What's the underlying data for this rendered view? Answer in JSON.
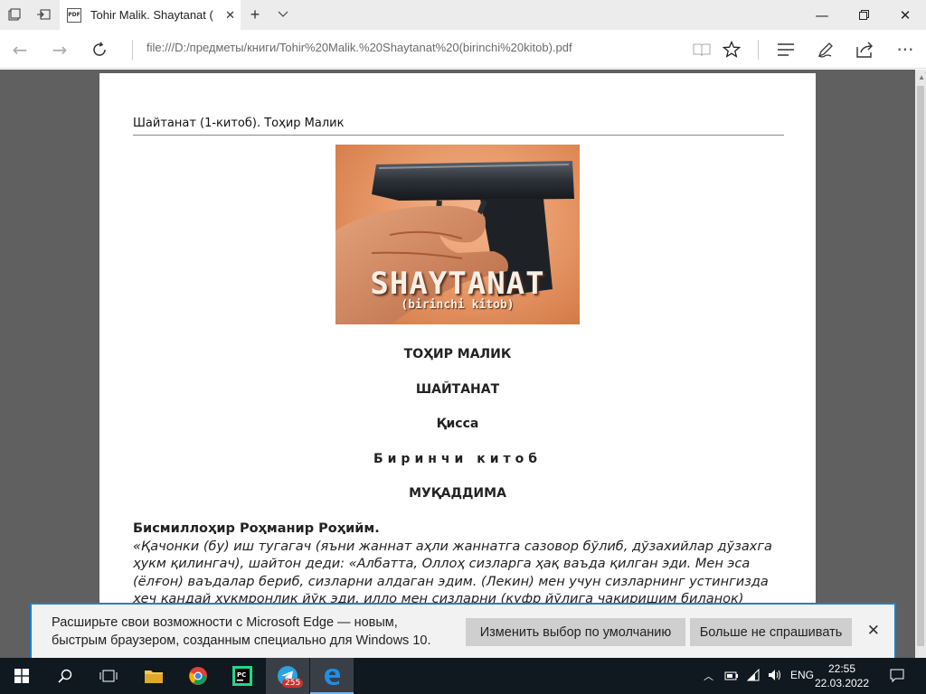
{
  "browser": {
    "tab_title": "Tohir Malik. Shaytanat (",
    "tab_icon": "pdf-icon",
    "address": "file:///D:/предметы/книги/Tohir%20Malik.%20Shaytanat%20(birinchi%20kitob).pdf",
    "accent": "#1b7fd6"
  },
  "document": {
    "running_head": "Шайтанат (1-китоб). Тоҳир Малик",
    "cover_title": "SHAYTANAT",
    "cover_subtitle": "(birinchi kitob)",
    "author": "ТОҲИР МАЛИК",
    "title": "ШАЙТАНАТ",
    "genre": "Қисса",
    "book": "Биринчи китоб",
    "section": "МУҚАДДИМА",
    "basmala": "Бисмиллоҳир Роҳманир Роҳийм.",
    "quote": "«Қачонки (бу) иш тугагач (яъни жаннат аҳли жаннатга сазовор бўлиб, дўзахийлар дўзахга ҳукм қилингач), шайтон деди: «Албатта, Оллоҳ сизларга ҳақ ваъда қилган эди. Мен эса (ёлғон) ваъдалар бериб, сизларни алдаган эдим. (Лекин) мен учун сизларнинг устингизда ҳеч қандай ҳукмронлик йўқ эди, илло мен сизларни (куфр йўлига чақиришим биланок) ўзингиз менга итоат"
  },
  "notification": {
    "text": "Расширьте свои возможности с Microsoft Edge — новым, быстрым браузером, созданным специально для Windows 10.",
    "primary_button": "Изменить выбор по умолчанию",
    "secondary_button": "Больше не спрашивать"
  },
  "taskbar": {
    "lang": "ENG",
    "time": "22:55",
    "date": "22.03.2022",
    "telegram_badge": "255"
  }
}
